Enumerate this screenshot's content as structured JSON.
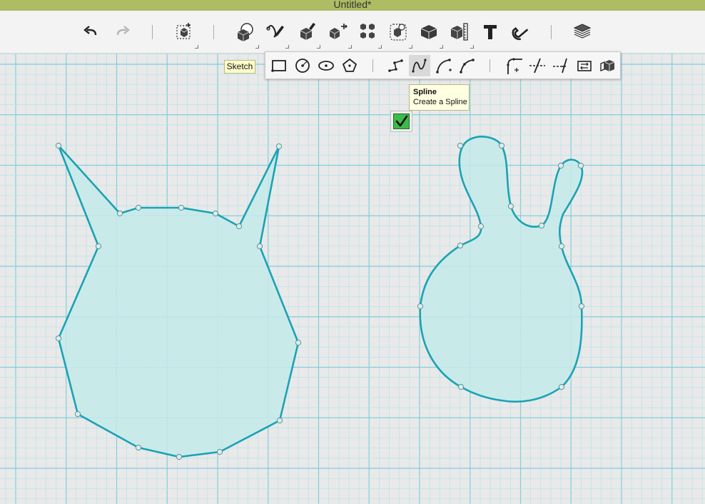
{
  "window": {
    "title": "Untitled*"
  },
  "toolbar": {
    "items": [
      {
        "icon": "undo-icon",
        "enabled": true
      },
      {
        "icon": "redo-icon",
        "enabled": false
      },
      {
        "icon": "transform-icon"
      },
      {
        "icon": "primitives-icon"
      },
      {
        "icon": "sketch-icon"
      },
      {
        "icon": "construct-icon"
      },
      {
        "icon": "modify-icon"
      },
      {
        "icon": "pattern-icon"
      },
      {
        "icon": "grouping-icon"
      },
      {
        "icon": "combine-icon"
      },
      {
        "icon": "measure-icon"
      },
      {
        "icon": "text-icon"
      },
      {
        "icon": "snap-icon"
      },
      {
        "icon": "material-icon"
      }
    ]
  },
  "sketch_label": "Sketch",
  "sketch_tools": [
    {
      "icon": "rectangle-icon"
    },
    {
      "icon": "circle-icon"
    },
    {
      "icon": "ellipse-icon"
    },
    {
      "icon": "polygon-icon"
    },
    {
      "icon": "polyline-icon"
    },
    {
      "icon": "spline-icon",
      "active": true
    },
    {
      "icon": "two-point-arc-icon"
    },
    {
      "icon": "three-point-arc-icon"
    },
    {
      "icon": "fillet-icon"
    },
    {
      "icon": "trim-icon"
    },
    {
      "icon": "extend-icon"
    },
    {
      "icon": "offset-icon"
    },
    {
      "icon": "project-icon"
    }
  ],
  "tooltip": {
    "title": "Spline",
    "description": "Create a Spline"
  },
  "colors": {
    "titlebar": "#aebc63",
    "canvas_bg": "#e9e9e9",
    "grid_minor": "#b8e3ea",
    "grid_major": "#7fcfdd",
    "shape_fill": "#c4eaea",
    "shape_stroke": "#1aa3b4",
    "confirm_green": "#3dbb48"
  }
}
